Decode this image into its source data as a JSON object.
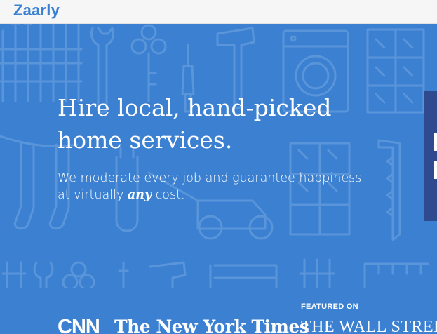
{
  "header": {
    "logo_text": "Zaarly"
  },
  "hero": {
    "headline_line1": "Hire local, hand-picked",
    "headline_line2": "home services.",
    "subline_before": "We moderate every job and guarantee happiness at virtually ",
    "subline_emphasis": "any",
    "subline_after": " cost."
  },
  "featured": {
    "label": "FEATURED ON",
    "outlets": [
      "CNN",
      "The New York Times",
      "THE WALL STREET JOU"
    ]
  },
  "colors": {
    "brand_blue": "#3c80d1",
    "pattern_blue": "#5a95da",
    "side_panel": "#2f4a8e",
    "topbar_bg": "#f6f6f6"
  }
}
